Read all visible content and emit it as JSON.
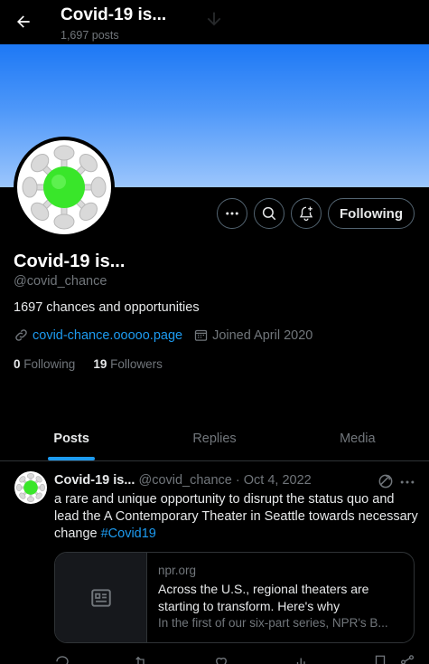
{
  "header": {
    "title": "Covid-19 is...",
    "post_count": "1,697 posts"
  },
  "profile": {
    "name": "Covid-19 is...",
    "handle": "@covid_chance",
    "bio": "1697 chances and opportunities",
    "website": "covid-chance.ooooo.page",
    "joined": "Joined April 2020",
    "following_count": "0",
    "following_label": "Following",
    "followers_count": "19",
    "followers_label": "Followers",
    "follow_button": "Following"
  },
  "tabs": [
    {
      "label": "Posts"
    },
    {
      "label": "Replies"
    },
    {
      "label": "Media"
    }
  ],
  "post": {
    "name": "Covid-19 is...",
    "handle": "@covid_chance",
    "separator": "·",
    "date": "Oct 4, 2022",
    "text": "a rare and unique opportunity to disrupt the status quo and lead the A Contemporary Theater in Seattle towards necessary change",
    "hashtag": "#Covid19",
    "card": {
      "domain": "npr.org",
      "title": "Across the U.S., regional theaters are starting to transform. Here's why",
      "description": "In the first of our six-part series, NPR's B..."
    }
  },
  "colors": {
    "accent": "#1d9bf0",
    "virus_green": "#39e62a",
    "muted": "#71767b"
  },
  "icons": [
    "back-arrow-icon",
    "more-icon",
    "search-icon",
    "bell-plus-icon",
    "link-icon",
    "calendar-icon",
    "article-icon",
    "reply-icon",
    "retweet-icon",
    "like-icon",
    "views-icon",
    "bookmark-icon",
    "share-icon"
  ]
}
